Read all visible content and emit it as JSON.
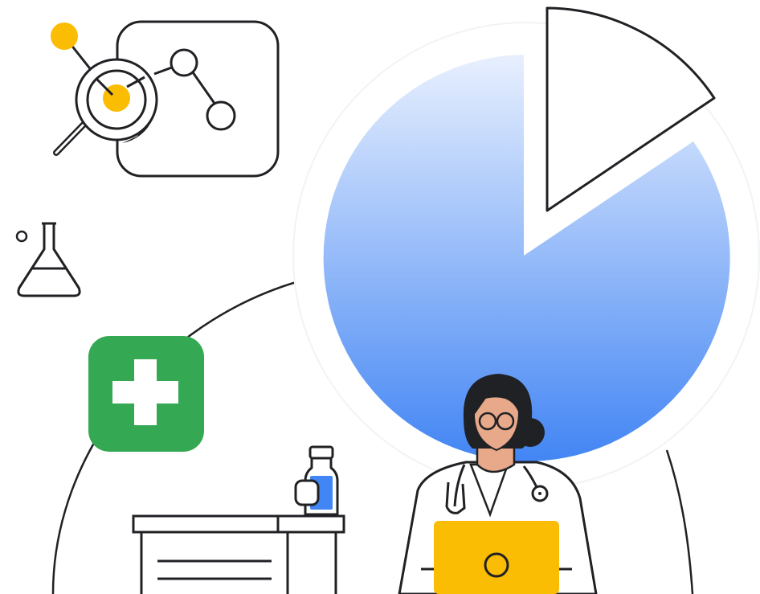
{
  "illustration": {
    "colors": {
      "outline": "#202124",
      "accent_yellow": "#FBBC04",
      "accent_green": "#34A853",
      "pie_gradient_top": "#E8F0FE",
      "pie_gradient_bottom": "#4285F4",
      "skin": "#E8A98A",
      "hair": "#202124",
      "laptop": "#FBBC04",
      "vial_liquid": "#4285F4",
      "background": "#FFFFFF"
    },
    "icons": [
      "magnifier-icon",
      "network-graph-icon",
      "flask-icon",
      "medical-cross-icon",
      "pie-chart-icon",
      "medicine-bottle-icon",
      "stethoscope-icon",
      "laptop-icon"
    ]
  }
}
